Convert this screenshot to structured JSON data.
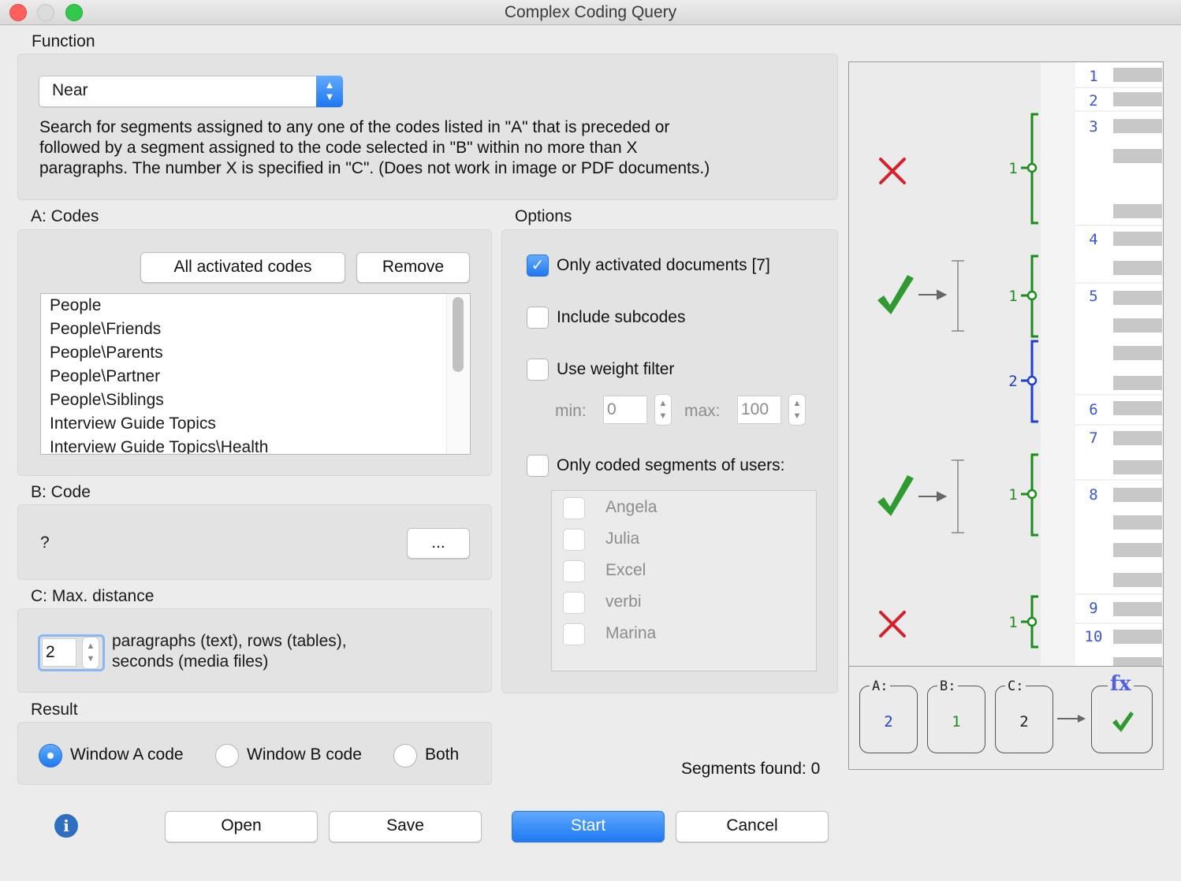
{
  "window": {
    "title": "Complex Coding Query"
  },
  "function_section": {
    "heading": "Function",
    "selected": "Near",
    "description_lines": [
      "Search for segments assigned to any one of the codes listed in \"A\" that is preceded or",
      "followed by a segment assigned to the code selected in \"B\" within no more than X",
      "paragraphs. The number X is specified in \"C\". (Does not work in image or PDF documents.)"
    ]
  },
  "codes_a": {
    "heading": "A: Codes",
    "all_button": "All activated codes",
    "remove_button": "Remove",
    "items": [
      "People",
      "People\\Friends",
      "People\\Parents",
      "People\\Partner",
      "People\\Siblings",
      "Interview Guide Topics",
      "Interview Guide Topics\\Health"
    ]
  },
  "code_b": {
    "heading": "B: Code",
    "value": "?",
    "browse_button": "..."
  },
  "max_distance": {
    "heading": "C: Max. distance",
    "value": "2",
    "unit_line1": "paragraphs (text), rows (tables),",
    "unit_line2": "seconds (media files)"
  },
  "result": {
    "heading": "Result",
    "options": [
      "Window A code",
      "Window B code",
      "Both"
    ],
    "selected": "Window A code"
  },
  "options": {
    "heading": "Options",
    "only_activated_documents": {
      "label": "Only activated documents [7]",
      "checked": true
    },
    "include_subcodes": {
      "label": "Include subcodes",
      "checked": false
    },
    "use_weight_filter": {
      "label": "Use weight filter",
      "checked": false
    },
    "min_label": "min:",
    "min_value": "0",
    "max_label": "max:",
    "max_value": "100",
    "only_coded_segments_of_users": {
      "label": "Only coded segments of users:",
      "checked": false
    },
    "users": [
      "Angela",
      "Julia",
      "Excel",
      "verbi",
      "Marina"
    ]
  },
  "status": {
    "segments_found": "Segments found: 0"
  },
  "buttons": {
    "open": "Open",
    "save": "Save",
    "start": "Start",
    "cancel": "Cancel"
  },
  "diagram": {
    "line_numbers": [
      "1",
      "2",
      "3",
      "4",
      "5",
      "6",
      "7",
      "8",
      "9",
      "10"
    ],
    "segment_codes": [
      "1",
      "1",
      "2",
      "1",
      "1"
    ],
    "match_results": [
      "no-match",
      "match",
      "match",
      "no-match"
    ],
    "colors": {
      "code1": "#1a8c1a",
      "code2": "#1b3fd6",
      "cross": "#d6202a",
      "check": "#2f9a2f"
    }
  },
  "formula": {
    "a_label": "A:",
    "a_value": "2",
    "b_label": "B:",
    "b_value": "1",
    "c_label": "C:",
    "c_value": "2",
    "fx_label": "fx"
  }
}
